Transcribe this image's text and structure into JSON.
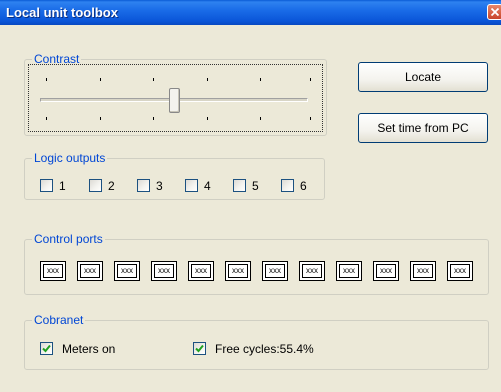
{
  "window": {
    "title": "Local unit toolbox"
  },
  "contrast": {
    "legend": "Contrast",
    "level": 0.5
  },
  "buttons": {
    "locate": "Locate",
    "set_time": "Set time from PC"
  },
  "logic_outputs": {
    "legend": "Logic outputs",
    "items": [
      {
        "label": "1",
        "checked": false
      },
      {
        "label": "2",
        "checked": false
      },
      {
        "label": "3",
        "checked": false
      },
      {
        "label": "4",
        "checked": false
      },
      {
        "label": "5",
        "checked": false
      },
      {
        "label": "6",
        "checked": false
      }
    ]
  },
  "control_ports": {
    "legend": "Control ports",
    "ports": [
      "xxx",
      "xxx",
      "xxx",
      "xxx",
      "xxx",
      "xxx",
      "xxx",
      "xxx",
      "xxx",
      "xxx",
      "xxx",
      "xxx"
    ]
  },
  "cobranet": {
    "legend": "Cobranet",
    "meters_label": "Meters on",
    "meters_checked": true,
    "free_cycles_label": "Free cycles:55.4%",
    "free_cycles_checked": true
  },
  "colors": {
    "legend_text": "#0046D5",
    "titlebar": "#0A55D8",
    "window_bg": "#ECE9D8"
  }
}
